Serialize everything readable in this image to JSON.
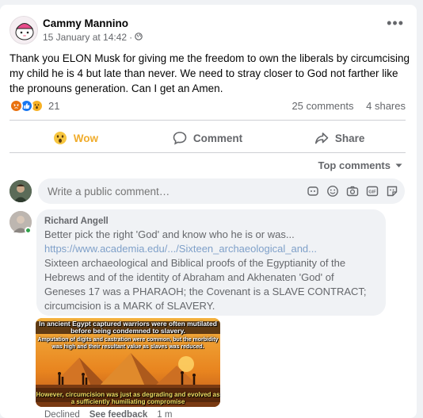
{
  "post": {
    "author": "Cammy Mannino",
    "date": "15 January at 14:42",
    "privacy_icon": "globe-icon",
    "more_label": "•••",
    "text": "Thank you ELON Musk for giving me the freedom to own the liberals by circumcising my child he is 4 but late than never. We need to stray closer to God not farther like the pronouns generation. Can I get an Amen."
  },
  "stats": {
    "reaction_count": "21",
    "reactions": [
      "angry",
      "like",
      "wow"
    ],
    "comments": "25 comments",
    "shares": "4 shares"
  },
  "actions": {
    "wow_label": "Wow",
    "comment_label": "Comment",
    "share_label": "Share"
  },
  "comments_sort": {
    "label": "Top comments"
  },
  "composer": {
    "placeholder": "Write a public comment…"
  },
  "comment": {
    "author": "Richard Angell",
    "line1": "Better pick the right 'God' and know who he is or was...",
    "link": "https://www.academia.edu/.../Sixteen_archaeological_and...",
    "body": "Sixteen archaeological and Biblical proofs of the Egyptianity of the Hebrews and of the identity of Abraham and Akhenaten 'God' of Geneses 17 was a PHARAOH; the Covenant is a SLAVE CONTRACT; circumcision is a MARK of SLAVERY.",
    "image_text": {
      "top": "In ancient Egypt captured warriors were often mutilated before being condemned to slavery.",
      "middle": "Amputation of digits and castration were common, but the morbidity was high and their resultant value as slaves was reduced.",
      "bottom": "However, circumcision was just as degrading and evolved as a sufficiently humiliating compromise"
    },
    "footer": {
      "status": "Declined",
      "feedback": "See feedback",
      "time": "1 m"
    }
  },
  "colors": {
    "wow": "#f0ac2c",
    "link": "#7fa0c9",
    "muted": "#65676b",
    "like": "#1877f2",
    "angry": "#e9710f"
  }
}
